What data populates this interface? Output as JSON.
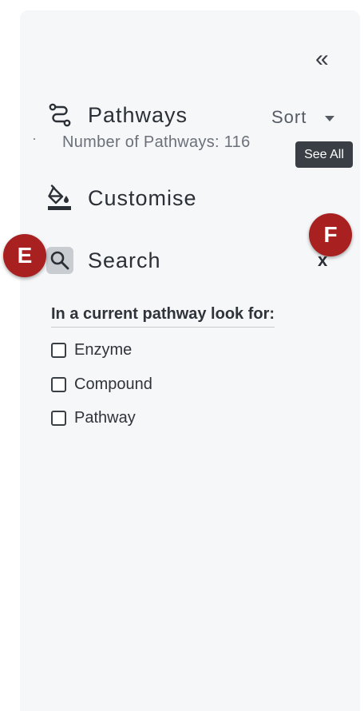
{
  "panel": {
    "collapse_glyph": "«",
    "colors": {
      "panel_bg": "#f6f7f9",
      "badge": "#a82020",
      "tooltip_bg": "#3a3f45",
      "search_icon_bg": "#c9ccd1"
    }
  },
  "pathways": {
    "title": "Pathways",
    "icon": "route-icon",
    "sort_label": "Sort",
    "count_label": "Number of Pathways: 116",
    "see_all_label": "See All"
  },
  "customise": {
    "title": "Customise",
    "icon": "paint-bucket-icon"
  },
  "search": {
    "title": "Search",
    "icon": "search-icon",
    "close_label": "x"
  },
  "filters": {
    "heading": "In a current pathway look for:",
    "options": [
      {
        "label": "Enzyme",
        "checked": false
      },
      {
        "label": "Compound",
        "checked": false
      },
      {
        "label": "Pathway",
        "checked": false
      }
    ]
  },
  "annotations": {
    "badge_e": "E",
    "badge_f": "F"
  }
}
